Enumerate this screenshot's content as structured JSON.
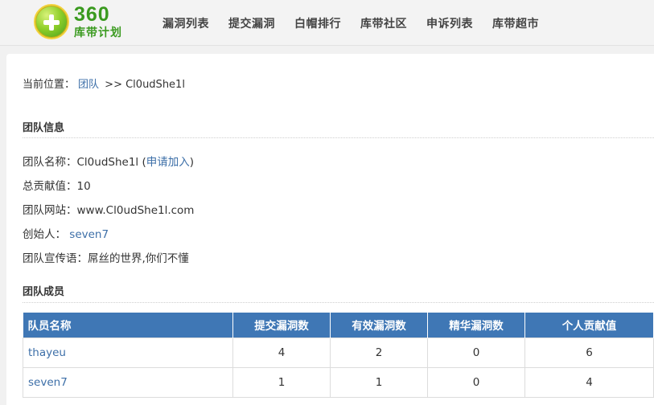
{
  "logo": {
    "number": "360",
    "subtitle": "库带计划"
  },
  "nav": [
    "漏洞列表",
    "提交漏洞",
    "白帽排行",
    "库带社区",
    "申诉列表",
    "库带超市"
  ],
  "breadcrumb": {
    "prefix": "当前位置：",
    "link": "团队",
    "separator": ">>",
    "current": "Cl0udShe1l"
  },
  "team_info": {
    "title": "团队信息",
    "name_label": "团队名称：",
    "name_value": "Cl0udShe1l",
    "join_open": "(",
    "join_link": "申请加入",
    "join_close": ")",
    "contribution_label": "总贡献值：",
    "contribution_value": "10",
    "website_label": "团队网站：",
    "website_value": "www.Cl0udShe1l.com",
    "founder_label": "创始人：",
    "founder_value": "seven7",
    "slogan_label": "团队宣传语：",
    "slogan_value": "屌丝的世界,你们不懂"
  },
  "members": {
    "title": "团队成员",
    "headers": [
      "队员名称",
      "提交漏洞数",
      "有效漏洞数",
      "精华漏洞数",
      "个人贡献值"
    ],
    "rows": [
      [
        "thayeu",
        "4",
        "2",
        "0",
        "6"
      ],
      [
        "seven7",
        "1",
        "1",
        "0",
        "4"
      ]
    ]
  },
  "colors": {
    "accent": "#3f77b5",
    "link": "#3d6fa8",
    "brand": "#3a9a1f"
  }
}
